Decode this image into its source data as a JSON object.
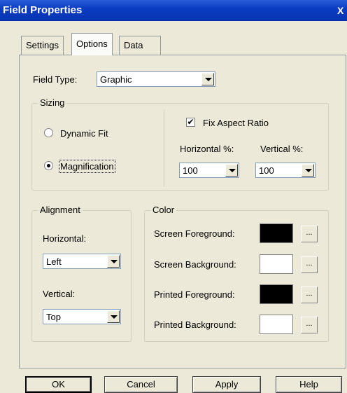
{
  "window": {
    "title": "Field Properties",
    "close_glyph": "X"
  },
  "tabs": [
    {
      "label": "Settings",
      "active": false
    },
    {
      "label": "Options",
      "active": true
    },
    {
      "label": "Data",
      "active": false
    }
  ],
  "field_type": {
    "label": "Field Type:",
    "value": "Graphic"
  },
  "sizing": {
    "legend": "Sizing",
    "dynamic_fit": {
      "label": "Dynamic Fit",
      "selected": false
    },
    "magnification": {
      "label": "Magnification",
      "selected": true
    },
    "fix_aspect_ratio": {
      "label": "Fix Aspect Ratio",
      "checked": true
    },
    "horizontal_label": "Horizontal %:",
    "horizontal_value": "100",
    "vertical_label": "Vertical %:",
    "vertical_value": "100"
  },
  "alignment": {
    "legend": "Alignment",
    "horizontal_label": "Horizontal:",
    "horizontal_value": "Left",
    "vertical_label": "Vertical:",
    "vertical_value": "Top"
  },
  "color": {
    "legend": "Color",
    "rows": [
      {
        "label": "Screen Foreground:",
        "swatch": "#000000"
      },
      {
        "label": "Screen Background:",
        "swatch": "#ffffff"
      },
      {
        "label": "Printed Foreground:",
        "swatch": "#000000"
      },
      {
        "label": "Printed Background:",
        "swatch": "#ffffff"
      }
    ],
    "browse_label": "..."
  },
  "buttons": {
    "ok": "OK",
    "cancel": "Cancel",
    "apply": "Apply",
    "help": "Help"
  }
}
